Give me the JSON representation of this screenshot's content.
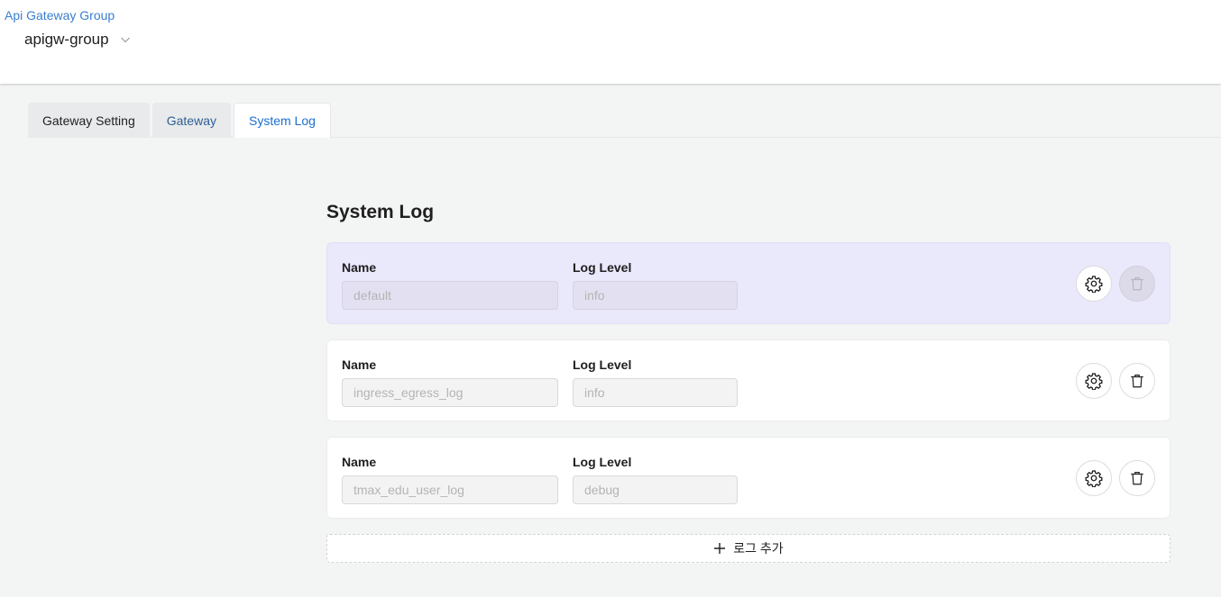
{
  "header": {
    "breadcrumb": "Api Gateway Group",
    "group_value": "apigw-group",
    "group_icon": "chevron-down-icon"
  },
  "tabs": [
    {
      "label": "Gateway Setting"
    },
    {
      "label": "Gateway"
    },
    {
      "label": "System Log",
      "active": true
    }
  ],
  "section": {
    "title": "System Log"
  },
  "logs": [
    {
      "name_label": "Name",
      "name_value": "default",
      "level_label": "Log Level",
      "level_value": "info",
      "selected": true,
      "delete_disabled": true
    },
    {
      "name_label": "Name",
      "name_value": "ingress_egress_log",
      "level_label": "Log Level",
      "level_value": "info"
    },
    {
      "name_label": "Name",
      "name_value": "tmax_edu_user_log",
      "level_label": "Log Level",
      "level_value": "debug"
    }
  ],
  "icons": {
    "settings": "gear-icon",
    "delete": "trash-icon",
    "add": "plus-icon"
  },
  "add_button": {
    "label": "로그 추가"
  },
  "colors": {
    "accent": "#1a6fd0",
    "link": "#3a7fcf",
    "selected_row": "#eae8fb"
  }
}
